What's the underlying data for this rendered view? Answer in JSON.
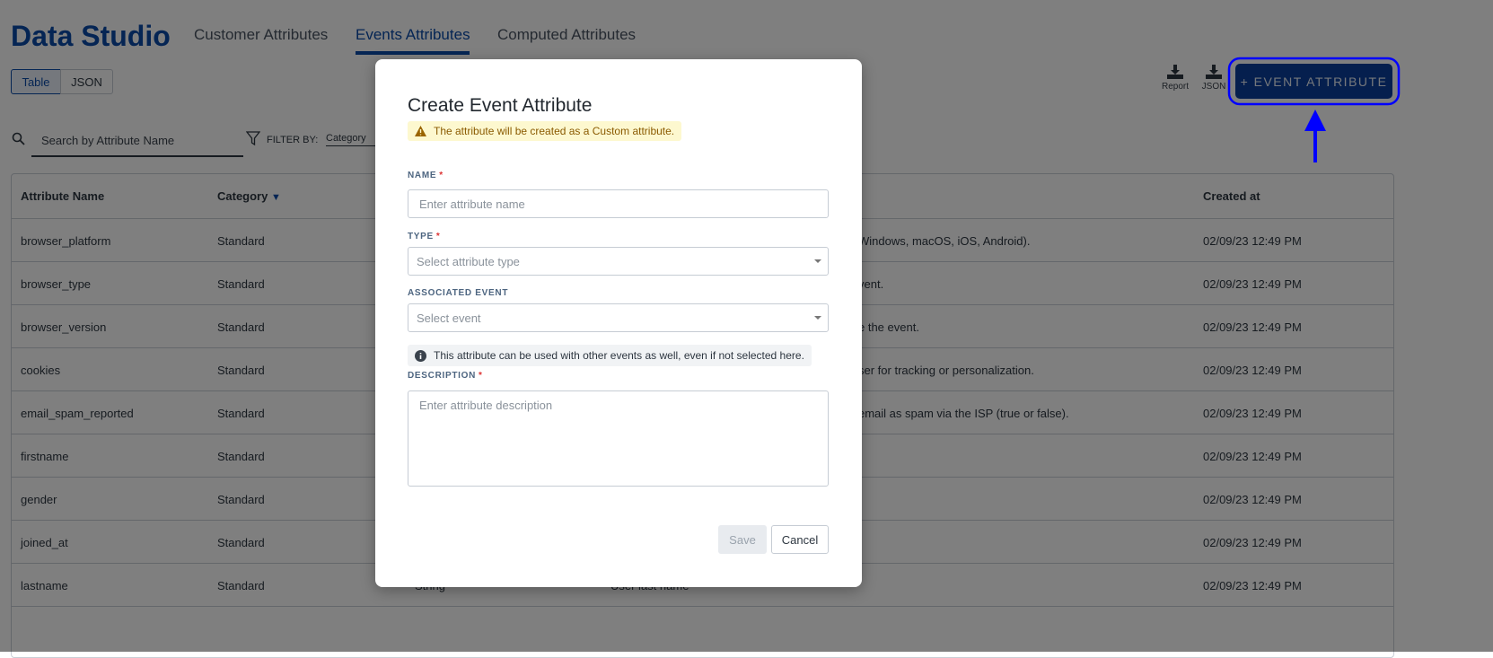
{
  "app": {
    "title": "Data Studio"
  },
  "tabs": [
    {
      "label": "Customer Attributes"
    },
    {
      "label": "Events Attributes",
      "active": true
    },
    {
      "label": "Computed Attributes"
    }
  ],
  "view_toggle": {
    "table": "Table",
    "json": "JSON",
    "selected": "Table"
  },
  "downloads": {
    "report": "Report",
    "json": "JSON"
  },
  "add_button": "+ EVENT ATTRIBUTE",
  "search": {
    "placeholder": "Search by Attribute Name"
  },
  "filter": {
    "label": "FILTER BY:",
    "category": "Category"
  },
  "table": {
    "headers": [
      "Attribute Name",
      "Category",
      "Created at"
    ],
    "rows": [
      {
        "name": "browser_platform",
        "category": "Standard",
        "description": "Windows, macOS, iOS, Android).",
        "created": "02/09/23 12:49 PM"
      },
      {
        "name": "browser_type",
        "category": "Standard",
        "description": "vent.",
        "created": "02/09/23 12:49 PM"
      },
      {
        "name": "browser_version",
        "category": "Standard",
        "description": "e the event.",
        "created": "02/09/23 12:49 PM"
      },
      {
        "name": "cookies",
        "category": "Standard",
        "description": "ser for tracking or personalization.",
        "created": "02/09/23 12:49 PM"
      },
      {
        "name": "email_spam_reported",
        "category": "Standard",
        "description": "email as spam via the ISP (true or false).",
        "created": "02/09/23 12:49 PM"
      },
      {
        "name": "firstname",
        "category": "Standard",
        "description": "",
        "created": "02/09/23 12:49 PM"
      },
      {
        "name": "gender",
        "category": "Standard",
        "description": "",
        "created": "02/09/23 12:49 PM"
      },
      {
        "name": "joined_at",
        "category": "Standard",
        "description": "",
        "created": "02/09/23 12:49 PM"
      },
      {
        "name": "lastname",
        "category": "Standard",
        "type": "String",
        "description": "User last name",
        "created": "02/09/23 12:49 PM"
      }
    ]
  },
  "modal": {
    "title": "Create Event Attribute",
    "warning": "The attribute will be created as a Custom attribute.",
    "name_label": "NAME",
    "name_placeholder": "Enter attribute name",
    "type_label": "TYPE",
    "type_placeholder": "Select attribute type",
    "event_label": "ASSOCIATED EVENT",
    "event_placeholder": "Select event",
    "info": "This attribute can be used with other events as well, even if not selected here.",
    "desc_label": "DESCRIPTION",
    "desc_placeholder": "Enter attribute description",
    "required": "*",
    "save": "Save",
    "cancel": "Cancel"
  },
  "colors": {
    "brand": "#0a4aa8",
    "annotation": "#0000ff",
    "warning_bg": "#fdf8cf"
  }
}
